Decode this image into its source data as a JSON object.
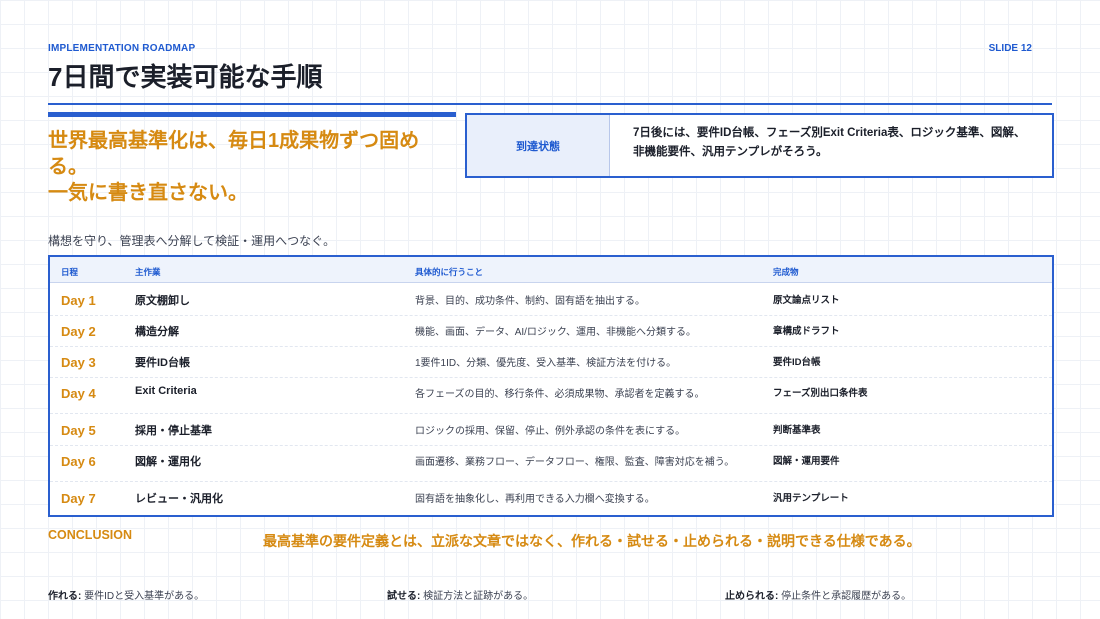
{
  "header": {
    "eyebrow": "IMPLEMENTATION ROADMAP",
    "slide_number": "SLIDE 12",
    "title": "7日間で実装可能な手順"
  },
  "headline": {
    "lines": [
      "世界最高基準化は、毎日1成果物ずつ固め",
      "る。",
      "一気に書き直さない。"
    ]
  },
  "state_box": {
    "label": "到達状態",
    "text": "7日後には、要件ID台帳、フェーズ別Exit Criteria表、ロジック基準、図解、非機能要件、汎用テンプレがそろう。"
  },
  "subtitle": "構想を守り、管理表へ分解して検証・運用へつなぐ。",
  "table": {
    "headers": [
      "日程",
      "主作業",
      "具体的に行うこと",
      "完成物"
    ],
    "rows": [
      {
        "day": "Day 1",
        "task": "原文棚卸し",
        "desc": "背景、目的、成功条件、制約、固有語を抽出する。",
        "output": "原文論点リスト"
      },
      {
        "day": "Day 2",
        "task": "構造分解",
        "desc": "機能、画面、データ、AI/ロジック、運用、非機能へ分類する。",
        "output": "章構成ドラフト"
      },
      {
        "day": "Day 3",
        "task": "要件ID台帳",
        "desc": "1要件1ID、分類、優先度、受入基準、検証方法を付ける。",
        "output": "要件ID台帳"
      },
      {
        "day": "Day 4",
        "task": "Exit Criteria",
        "desc": "各フェーズの目的、移行条件、必須成果物、承認者を定義する。",
        "output": "フェーズ別出口条件表"
      },
      {
        "day": "Day 5",
        "task": "採用・停止基準",
        "desc": "ロジックの採用、保留、停止、例外承認の条件を表にする。",
        "output": "判断基準表"
      },
      {
        "day": "Day 6",
        "task": "図解・運用化",
        "desc": "画面遷移、業務フロー、データフロー、権限、監査、障害対応を補う。",
        "output": "図解・運用要件"
      },
      {
        "day": "Day 7",
        "task": "レビュー・汎用化",
        "desc": "固有語を抽象化し、再利用できる入力欄へ変換する。",
        "output": "汎用テンプレート"
      }
    ]
  },
  "conclusion": {
    "label": "CONCLUSION",
    "text": "最高基準の要件定義とは、立派な文章ではなく、作れる・試せる・止められる・説明できる仕様である。"
  },
  "footer": [
    {
      "key": "作れる:",
      "value": " 要件IDと受入基準がある。"
    },
    {
      "key": "試せる:",
      "value": " 検証方法と証跡がある。"
    },
    {
      "key": "止められる:",
      "value": " 停止条件と承認履歴がある。"
    }
  ],
  "colors": {
    "accent_blue": "#2a5fcf",
    "accent_orange": "#d68a12"
  }
}
